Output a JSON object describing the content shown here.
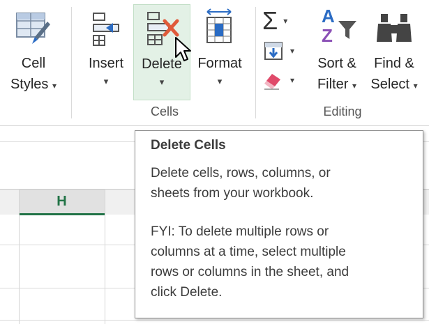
{
  "ribbon": {
    "cell_styles": {
      "label_line1": "Cell",
      "label_line2": "Styles",
      "caret": "▾",
      "icon": "cell-styles-icon"
    },
    "insert": {
      "label": "Insert",
      "caret": "▾",
      "icon": "insert-cells-icon"
    },
    "delete": {
      "label": "Delete",
      "caret": "▾",
      "icon": "delete-cells-icon",
      "state": "hover"
    },
    "format": {
      "label": "Format",
      "caret": "▾",
      "icon": "format-cells-icon"
    },
    "autosum": {
      "symbol": "Σ",
      "caret": "▾",
      "icon": "autosum-icon"
    },
    "fill": {
      "caret": "▾",
      "icon": "fill-down-icon"
    },
    "clear": {
      "caret": "▾",
      "icon": "eraser-icon"
    },
    "sort_filter": {
      "label_line1": "Sort &",
      "label_line2": "Filter",
      "caret": "▾",
      "icon": "sort-filter-icon",
      "letter_a": "A",
      "letter_z": "Z"
    },
    "find_select": {
      "label_line1": "Find &",
      "label_line2": "Select",
      "caret": "▾",
      "icon": "binoculars-icon"
    },
    "group_cells": "Cells",
    "group_editing": "Editing"
  },
  "sheet": {
    "selected_column": "H"
  },
  "tooltip": {
    "title": "Delete Cells",
    "body": "Delete cells, rows, columns, or\nsheets from your workbook.",
    "fyi": "FYI: To delete multiple rows or\ncolumns at a time, select multiple\nrows or columns in the sheet, and\nclick Delete."
  },
  "colors": {
    "accent_green": "#217346",
    "hover_bg": "#e3f1e6",
    "delete_x": "#e05a3a",
    "icon_blue": "#2b6cc4",
    "sort_purple": "#8a4fb5",
    "eraser_red": "#e04a6a"
  }
}
